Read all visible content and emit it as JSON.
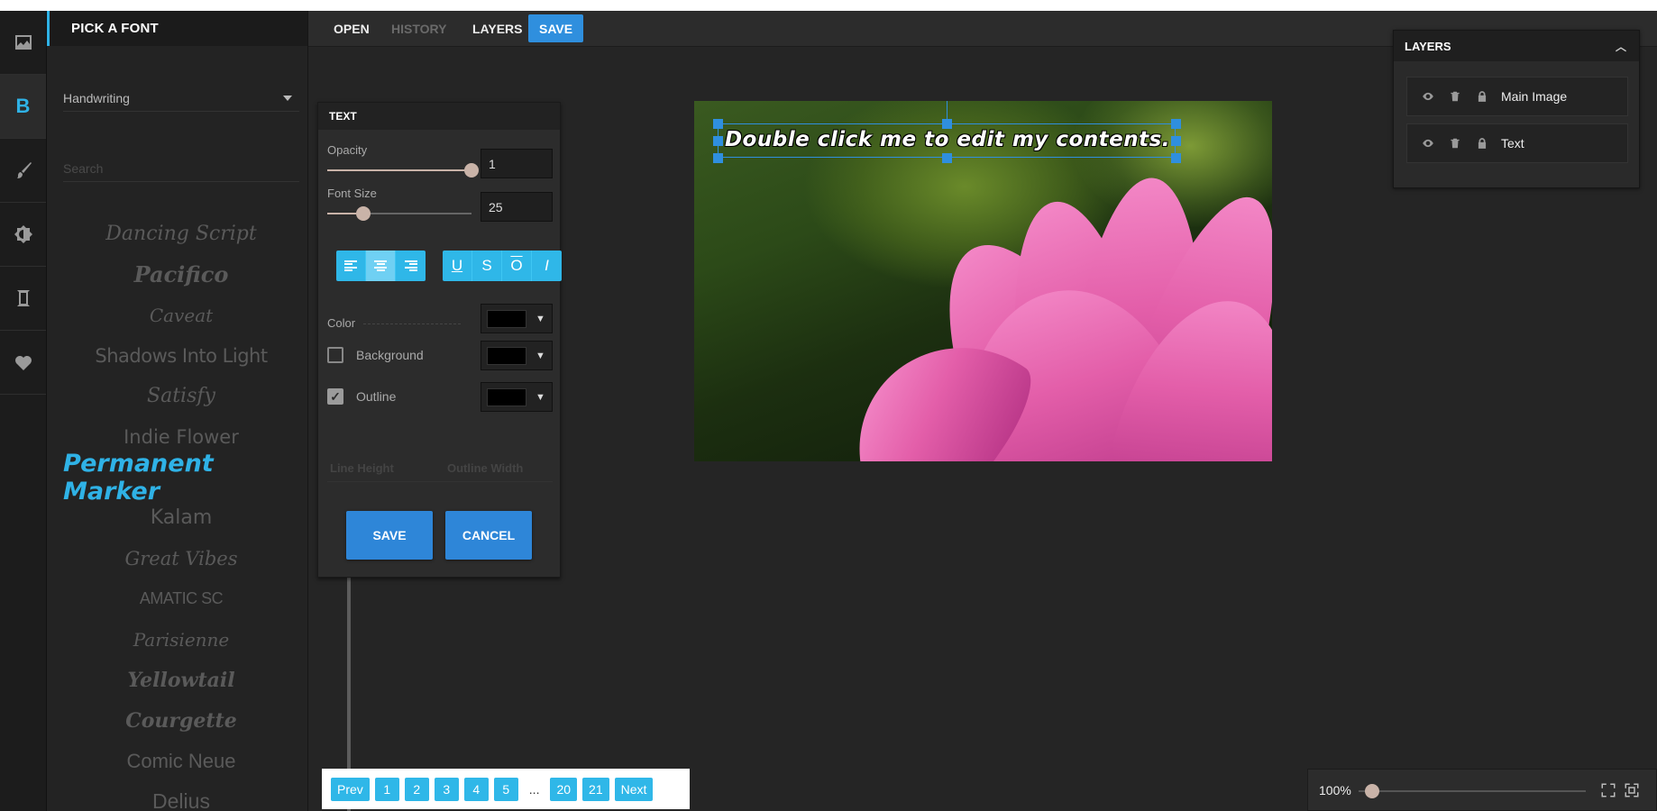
{
  "font_panel": {
    "title": "PICK A FONT",
    "category": "Handwriting",
    "search_placeholder": "Search",
    "fonts": [
      {
        "label": "Dancing Script"
      },
      {
        "label": "Pacifico"
      },
      {
        "label": "Caveat"
      },
      {
        "label": "Shadows Into Light"
      },
      {
        "label": "Satisfy"
      },
      {
        "label": "Indie Flower"
      },
      {
        "label": "Permanent Marker"
      },
      {
        "label": "Kalam"
      },
      {
        "label": "Great Vibes"
      },
      {
        "label": "AMATIC SC"
      },
      {
        "label": "Parisienne"
      },
      {
        "label": "Yellowtail"
      },
      {
        "label": "Courgette"
      },
      {
        "label": "Comic Neue"
      },
      {
        "label": "Delius"
      }
    ],
    "selected_font": "Permanent Marker"
  },
  "toolbar": {
    "open_label": "OPEN",
    "history_label": "HISTORY",
    "layers_label": "LAYERS",
    "save_label": "SAVE"
  },
  "text_panel": {
    "title": "TEXT",
    "opacity_label": "Opacity",
    "opacity_value": "1",
    "opacity_level": 1.0,
    "font_size_label": "Font Size",
    "font_size_value": "25",
    "font_size_level": 0.25,
    "color_label": "Color",
    "background_label": "Background",
    "background_checked": false,
    "outline_label": "Outline",
    "outline_checked": true,
    "line_height_label": "Line Height",
    "outline_width_label": "Outline Width",
    "save_label": "SAVE",
    "cancel_label": "CANCEL",
    "color_value": "#000000",
    "background_value": "#000000",
    "outline_value": "#000000"
  },
  "canvas": {
    "text_content": "Double click me to edit my contents."
  },
  "layers": {
    "title": "LAYERS",
    "items": [
      {
        "name": "Main Image"
      },
      {
        "name": "Text"
      }
    ]
  },
  "pagination": {
    "prev_label": "Prev",
    "pages": [
      "1",
      "2",
      "3",
      "4",
      "5"
    ],
    "ellipsis": "...",
    "tail_pages": [
      "20",
      "21"
    ],
    "next_label": "Next"
  },
  "zoom": {
    "value_label": "100%",
    "level": 0.06
  },
  "colors": {
    "accent": "#2fb2e6",
    "primary_button": "#2f8fde"
  }
}
